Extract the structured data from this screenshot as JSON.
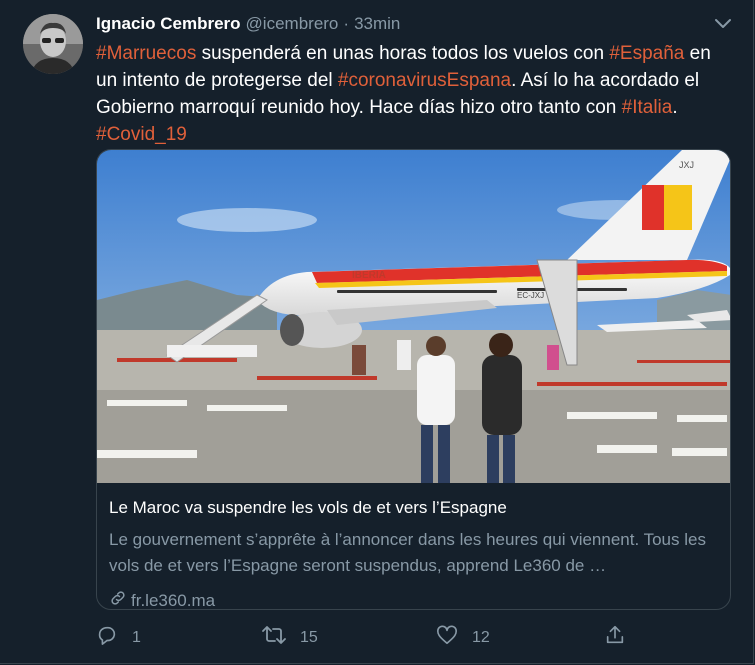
{
  "tweet": {
    "author_name": "Ignacio Cembrero",
    "author_handle": "@icembrero",
    "separator": "·",
    "time": "33min",
    "text_parts": [
      {
        "text": "#Marruecos",
        "hashtag": true
      },
      {
        "text": " suspenderá en unas horas todos los vuelos con ",
        "hashtag": false
      },
      {
        "text": "#España",
        "hashtag": true
      },
      {
        "text": " en un intento de protegerse del ",
        "hashtag": false
      },
      {
        "text": "#coronavirusEspana",
        "hashtag": true
      },
      {
        "text": ". Así lo ha acordado el Gobierno marroquí reunido hoy. Hace días hizo otro tanto con ",
        "hashtag": false
      },
      {
        "text": "#Italia",
        "hashtag": true
      },
      {
        "text": ". ",
        "hashtag": false
      },
      {
        "text": "#Covid_19",
        "hashtag": true
      }
    ]
  },
  "card": {
    "title": "Le Maroc va suspendre les vols de et vers l’Espagne",
    "description": "Le gouvernement s’apprête à l’annoncer dans les heures qui viennent. Tous les vols de et vers l’Espagne seront suspendus, apprend Le360 de …",
    "domain": "fr.le360.ma",
    "image_text": {
      "airline": "IBERIA",
      "registration": "EC-JXJ",
      "tail_code": "JXJ"
    }
  },
  "actions": {
    "reply_count": "1",
    "retweet_count": "15",
    "like_count": "12"
  },
  "colors": {
    "background": "#15202b",
    "hashtag": "#e0603a",
    "muted": "#8899a6",
    "border": "#38444d"
  }
}
